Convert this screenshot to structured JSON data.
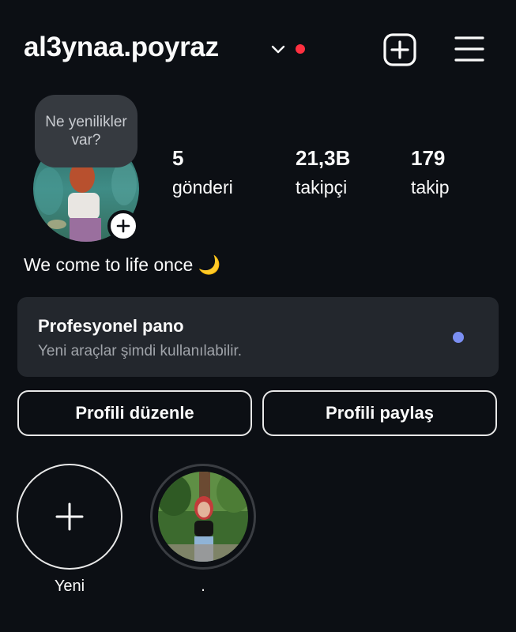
{
  "header": {
    "username": "al3ynaa.poyraz",
    "icons": {
      "dropdown": "chevron-down-icon",
      "create": "plus-square-icon",
      "menu": "hamburger-menu-icon"
    },
    "notification_color": "#ff3040"
  },
  "profile": {
    "note_text": "Ne yenilikler var?",
    "stats": [
      {
        "value": "5",
        "label": "gönderi"
      },
      {
        "value": "21,3B",
        "label": "takipçi"
      },
      {
        "value": "179",
        "label": "takip"
      }
    ],
    "bio": "We come to life once 🌙"
  },
  "pro_dashboard": {
    "title": "Profesyonel pano",
    "subtitle": "Yeni araçlar şimdi kullanılabilir.",
    "dot_color": "#7b8ff2"
  },
  "buttons": {
    "edit_profile": "Profili düzenle",
    "share_profile": "Profili paylaş"
  },
  "highlights": [
    {
      "label": "Yeni"
    },
    {
      "label": "."
    }
  ]
}
